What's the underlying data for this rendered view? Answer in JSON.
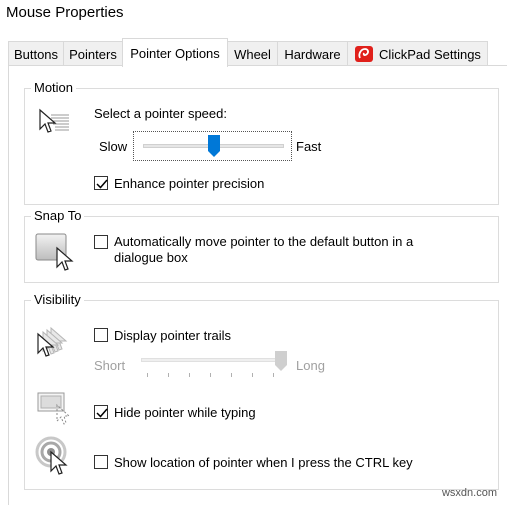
{
  "window": {
    "title": "Mouse Properties"
  },
  "tabs": [
    {
      "label": "Buttons"
    },
    {
      "label": "Pointers"
    },
    {
      "label": "Pointer Options"
    },
    {
      "label": "Wheel"
    },
    {
      "label": "Hardware"
    },
    {
      "label": "ClickPad Settings"
    }
  ],
  "motion": {
    "title": "Motion",
    "prompt": "Select a pointer speed:",
    "slow_label": "Slow",
    "fast_label": "Fast",
    "speed_fraction": 0.5,
    "enhance_label": "Enhance pointer precision",
    "enhance_checked": true
  },
  "snap_to": {
    "title": "Snap To",
    "line1": "Automatically move pointer to the default button in a",
    "line2": "dialogue box",
    "checked": false
  },
  "visibility": {
    "title": "Visibility",
    "trails_label": "Display pointer trails",
    "trails_checked": false,
    "short_label": "Short",
    "long_label": "Long",
    "trail_length_fraction": 1.0,
    "hide_label": "Hide pointer while typing",
    "hide_checked": true,
    "ctrl_label": "Show location of pointer when I press the CTRL key",
    "ctrl_checked": false
  },
  "watermark": "wsxdn.com",
  "colors": {
    "accent": "#0078d7",
    "check": "#000000",
    "clickpad_icon": "#e0201b"
  }
}
